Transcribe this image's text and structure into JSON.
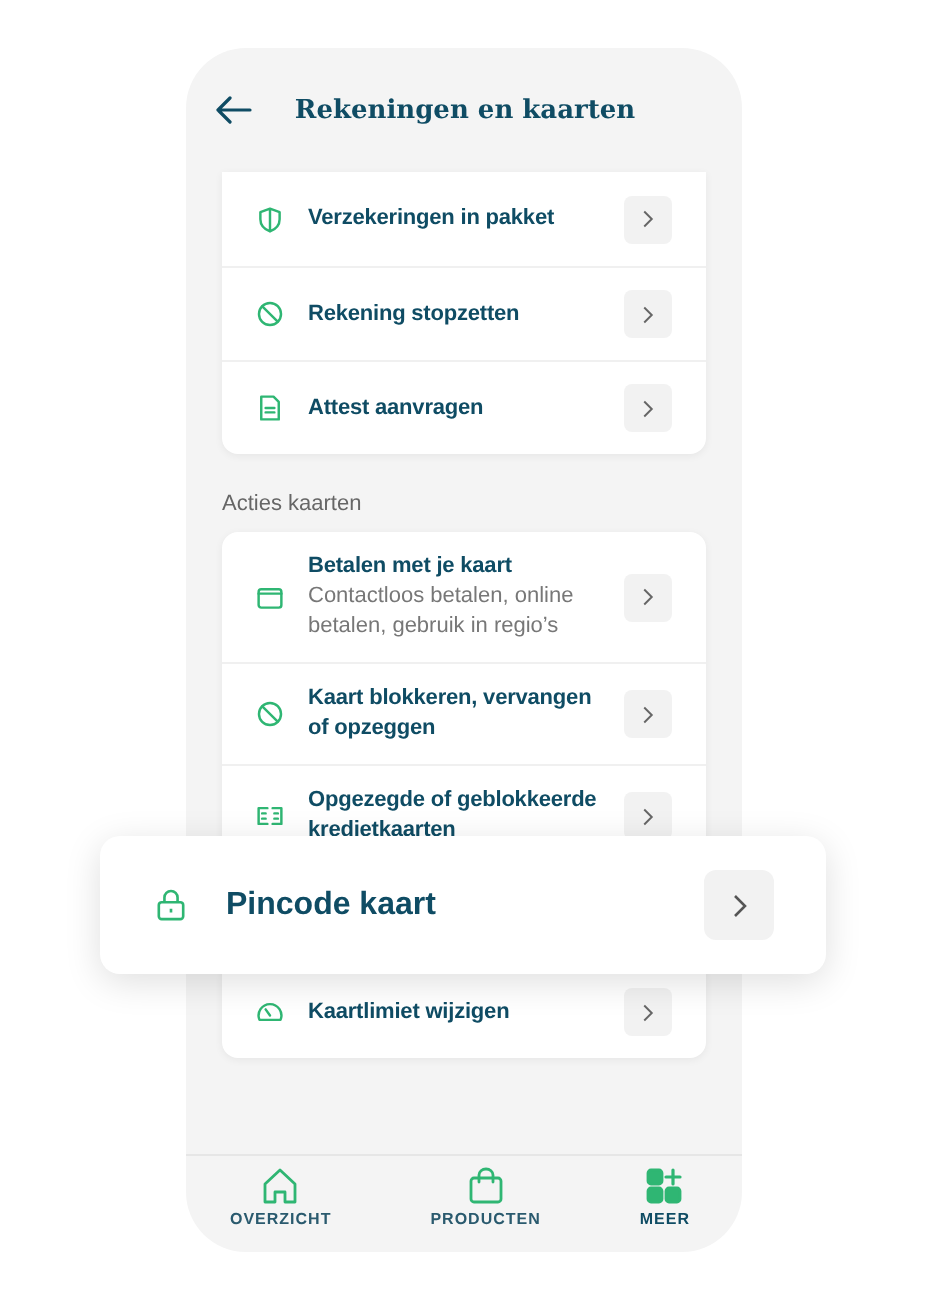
{
  "header": {
    "title": "Rekeningen en kaarten"
  },
  "account_actions": [
    {
      "kind": "shield",
      "label": "Verzekeringen in pakket"
    },
    {
      "kind": "ban",
      "label": "Rekening stopzetten"
    },
    {
      "kind": "document",
      "label": "Attest aanvragen"
    }
  ],
  "card_actions_heading": "Acties kaarten",
  "card_actions": [
    {
      "kind": "wallet",
      "label": "Betalen met je kaart",
      "description": "Contactloos betalen, online betalen, gebruik in regio’s"
    },
    {
      "kind": "ban",
      "label": "Kaart blokkeren, vervangen of opzeggen"
    },
    {
      "kind": "cards",
      "label": "Opgezegde of geblokkeerde kredietkaarten"
    },
    {
      "kind": "gauge",
      "label": "Kaartlimiet wijzigen"
    }
  ],
  "highlight": {
    "kind": "lock",
    "label": "Pincode kaart"
  },
  "nav": [
    {
      "kind": "home",
      "label": "OVERZICHT",
      "selected": false
    },
    {
      "kind": "bag",
      "label": "PRODUCTEN",
      "selected": false
    },
    {
      "kind": "grid",
      "label": "MEER",
      "selected": true
    }
  ]
}
